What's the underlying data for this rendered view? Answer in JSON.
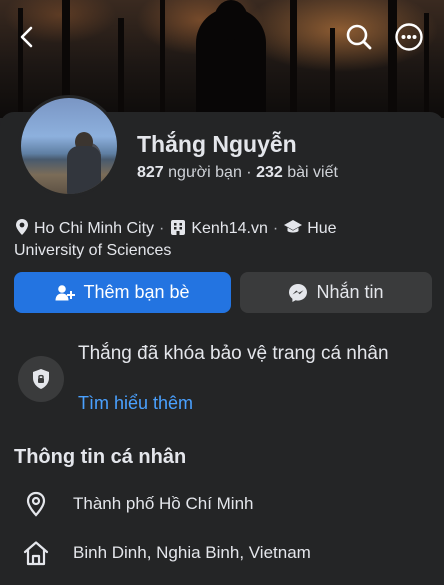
{
  "profile": {
    "name": "Thắng Nguyễn",
    "friends_count": "827",
    "friends_label": " người bạn · ",
    "posts_count": "232",
    "posts_label": " bài viết"
  },
  "details": {
    "location": "Ho Chi Minh City",
    "workplace": "Kenh14.vn",
    "education_part1": "Hue",
    "education_part2": "University of Sciences",
    "separator": "·"
  },
  "actions": {
    "add_friend": "Thêm bạn bè",
    "message": "Nhắn tin"
  },
  "privacy": {
    "text": "Thắng đã khóa bảo vệ trang cá nhân",
    "learn_more": "Tìm hiểu thêm"
  },
  "personal_info": {
    "title": "Thông tin cá nhân",
    "items": [
      {
        "icon": "location-pin-icon",
        "text": "Thành phố Hồ Chí Minh"
      },
      {
        "icon": "home-icon",
        "text": "Binh Dinh, Nghia Binh, Vietnam"
      }
    ]
  },
  "colors": {
    "background": "#242526",
    "primary": "#2374e1",
    "link": "#4aa1ff",
    "secondary_button": "#3a3b3c"
  }
}
